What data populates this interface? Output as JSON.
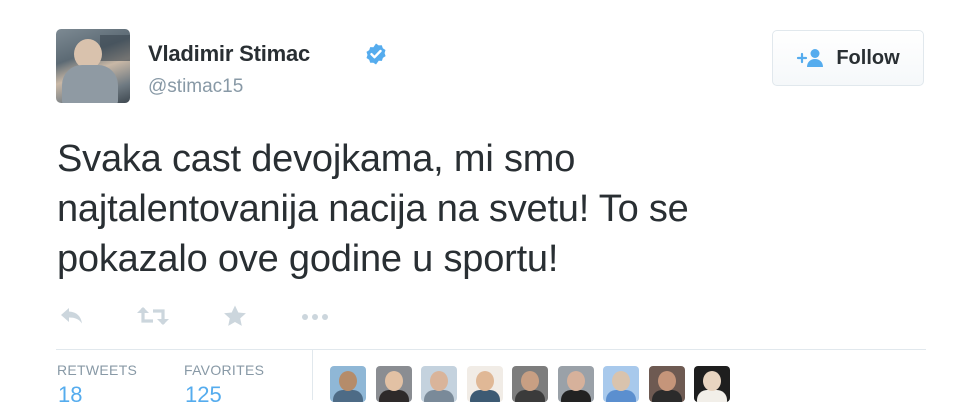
{
  "tweet": {
    "author_name": "Vladimir Stimac",
    "handle": "@stimac15",
    "text": "Svaka cast devojkama, mi smo\nnajtalentovanija nacija na svetu! To se\npokazalo ove godine u sportu!"
  },
  "follow_button": {
    "label": "Follow"
  },
  "actions": [
    "reply-icon",
    "retweet-icon",
    "favorite-icon",
    "more-icon"
  ],
  "stats": {
    "retweets_label": "RETWEETS",
    "retweets_value": "18",
    "favorites_label": "FAVORITES",
    "favorites_value": "125"
  },
  "colors": {
    "accent": "#55acee",
    "text": "#292f33",
    "muted": "#8899a6",
    "action_icon": "#ccd6dd"
  },
  "favoriters": [
    {
      "head": "#b58c6a",
      "body": "#4d6b86",
      "bg": "#8fb7d6"
    },
    {
      "head": "#e2c1a4",
      "body": "#2e2a2a",
      "bg": "#8a8d92"
    },
    {
      "head": "#d9b49a",
      "body": "#7a8a99",
      "bg": "#c4d2de"
    },
    {
      "head": "#e0b896",
      "body": "#3d5a73",
      "bg": "#f1ece6"
    },
    {
      "head": "#c89f83",
      "body": "#3b3b3b",
      "bg": "#7d7d7d"
    },
    {
      "head": "#d6b19b",
      "body": "#222222",
      "bg": "#9aa1a8"
    },
    {
      "head": "#d9c3ad",
      "body": "#5b8fcf",
      "bg": "#a8c9ec"
    },
    {
      "head": "#c5957a",
      "body": "#2b2b2b",
      "bg": "#6e5a52"
    },
    {
      "head": "#e8d4c0",
      "body": "#f2efe9",
      "bg": "#1e1e1e"
    }
  ]
}
